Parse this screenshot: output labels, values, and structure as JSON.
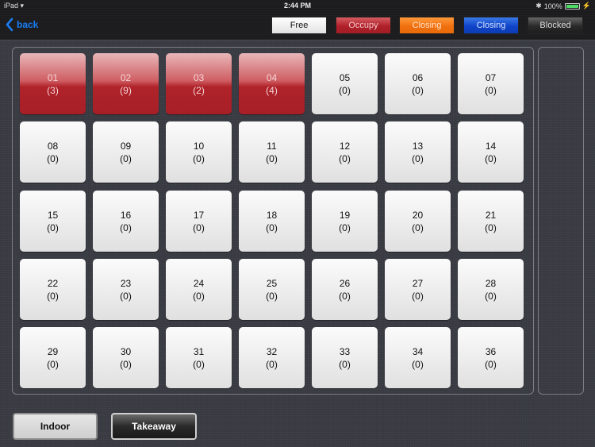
{
  "status_bar": {
    "device": "iPad",
    "time": "2:44 PM",
    "battery": "100%"
  },
  "nav": {
    "back_label": "back"
  },
  "legend": [
    {
      "label": "Free",
      "color": "#e8e8e8"
    },
    {
      "label": "Occupy",
      "color": "#b0202a"
    },
    {
      "label": "Closing",
      "color": "#f07010"
    },
    {
      "label": "Closing",
      "color": "#1045c8"
    },
    {
      "label": "Blocked",
      "color": "#2a2a2a"
    }
  ],
  "tables": [
    {
      "number": "01",
      "count": "(3)",
      "status": "occupied"
    },
    {
      "number": "02",
      "count": "(9)",
      "status": "occupied"
    },
    {
      "number": "03",
      "count": "(2)",
      "status": "occupied"
    },
    {
      "number": "04",
      "count": "(4)",
      "status": "occupied"
    },
    {
      "number": "05",
      "count": "(0)",
      "status": "free"
    },
    {
      "number": "06",
      "count": "(0)",
      "status": "free"
    },
    {
      "number": "07",
      "count": "(0)",
      "status": "free"
    },
    {
      "number": "08",
      "count": "(0)",
      "status": "free"
    },
    {
      "number": "09",
      "count": "(0)",
      "status": "free"
    },
    {
      "number": "10",
      "count": "(0)",
      "status": "free"
    },
    {
      "number": "11",
      "count": "(0)",
      "status": "free"
    },
    {
      "number": "12",
      "count": "(0)",
      "status": "free"
    },
    {
      "number": "13",
      "count": "(0)",
      "status": "free"
    },
    {
      "number": "14",
      "count": "(0)",
      "status": "free"
    },
    {
      "number": "15",
      "count": "(0)",
      "status": "free"
    },
    {
      "number": "16",
      "count": "(0)",
      "status": "free"
    },
    {
      "number": "17",
      "count": "(0)",
      "status": "free"
    },
    {
      "number": "18",
      "count": "(0)",
      "status": "free"
    },
    {
      "number": "19",
      "count": "(0)",
      "status": "free"
    },
    {
      "number": "20",
      "count": "(0)",
      "status": "free"
    },
    {
      "number": "21",
      "count": "(0)",
      "status": "free"
    },
    {
      "number": "22",
      "count": "(0)",
      "status": "free"
    },
    {
      "number": "23",
      "count": "(0)",
      "status": "free"
    },
    {
      "number": "24",
      "count": "(0)",
      "status": "free"
    },
    {
      "number": "25",
      "count": "(0)",
      "status": "free"
    },
    {
      "number": "26",
      "count": "(0)",
      "status": "free"
    },
    {
      "number": "27",
      "count": "(0)",
      "status": "free"
    },
    {
      "number": "28",
      "count": "(0)",
      "status": "free"
    },
    {
      "number": "29",
      "count": "(0)",
      "status": "free"
    },
    {
      "number": "30",
      "count": "(0)",
      "status": "free"
    },
    {
      "number": "31",
      "count": "(0)",
      "status": "free"
    },
    {
      "number": "32",
      "count": "(0)",
      "status": "free"
    },
    {
      "number": "33",
      "count": "(0)",
      "status": "free"
    },
    {
      "number": "34",
      "count": "(0)",
      "status": "free"
    },
    {
      "number": "36",
      "count": "(0)",
      "status": "free"
    }
  ],
  "bottom_tabs": {
    "indoor_label": "Indoor",
    "takeaway_label": "Takeaway"
  }
}
